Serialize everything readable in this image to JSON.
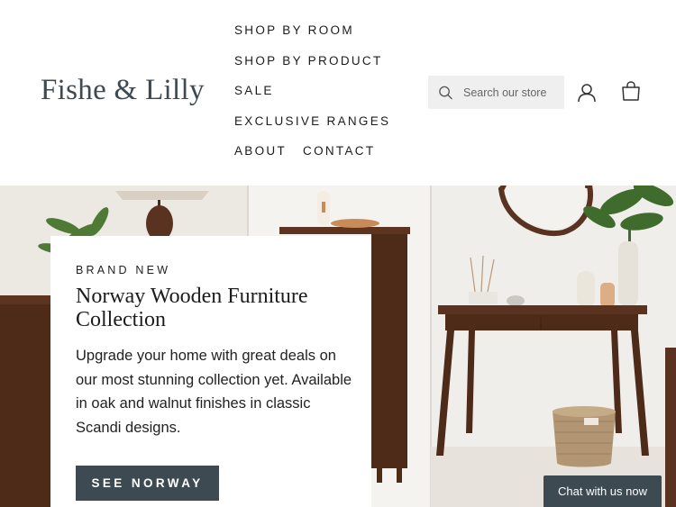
{
  "brand": {
    "logo_text": "Fishe & Lilly"
  },
  "nav": {
    "items": [
      {
        "label": "SHOP BY ROOM"
      },
      {
        "label": "SHOP BY PRODUCT"
      },
      {
        "label": "SALE"
      },
      {
        "label": "EXCLUSIVE RANGES"
      },
      {
        "label": "ABOUT"
      },
      {
        "label": "CONTACT"
      }
    ]
  },
  "search": {
    "placeholder": "Search our store",
    "icon": "search-icon"
  },
  "header_icons": {
    "account": "user-icon",
    "cart": "shopping-bag-icon"
  },
  "hero": {
    "eyebrow": "BRAND NEW",
    "title": "Norway Wooden Furniture Collection",
    "body": "Upgrade your home with great deals on our most stunning collection yet. Available in oak and walnut finishes in classic Scandi designs.",
    "cta_label": "SEE NORWAY"
  },
  "chat": {
    "label": "Chat with us now"
  },
  "colors": {
    "accent": "#3d4a52",
    "search_bg": "#efefef",
    "wood": "#5a3320"
  }
}
